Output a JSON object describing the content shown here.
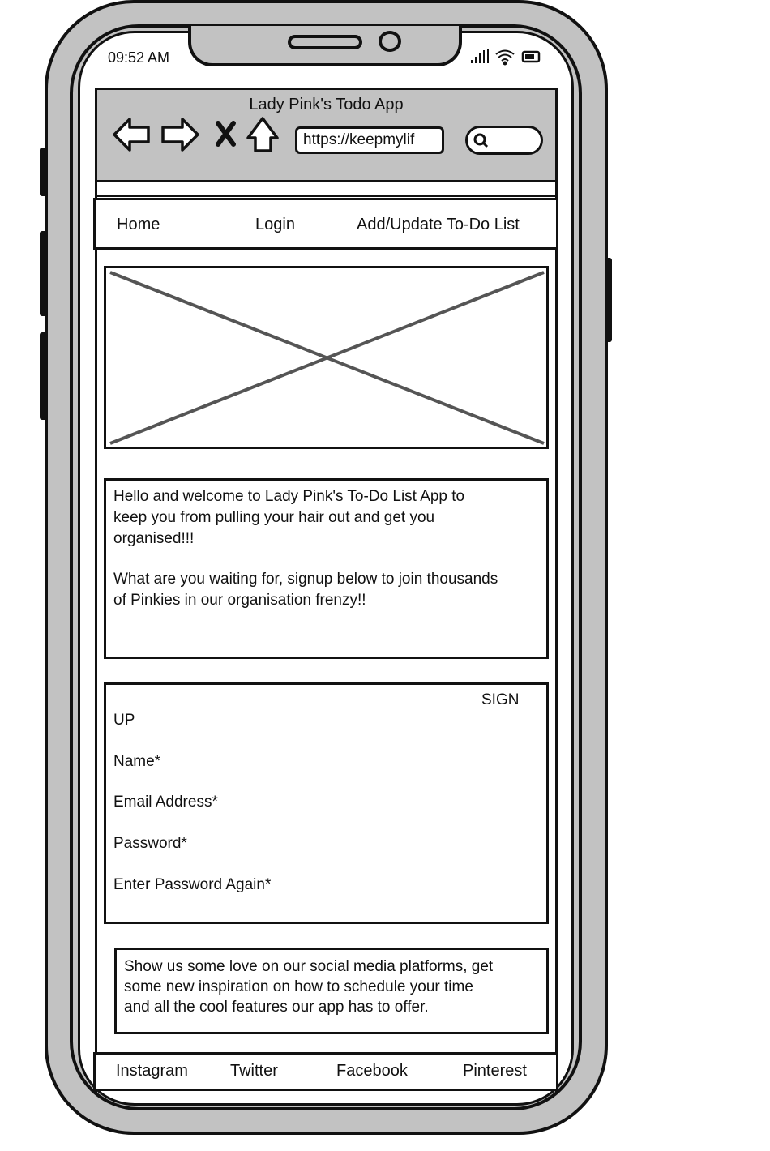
{
  "status_bar": {
    "time": "09:52 AM",
    "icons": [
      "signal-icon",
      "wifi-icon",
      "battery-icon"
    ]
  },
  "browser": {
    "title": "Lady Pink's Todo App",
    "url": "https://keepmylif",
    "nav_icons": [
      "back-arrow-icon",
      "forward-arrow-icon",
      "close-icon",
      "home-icon"
    ],
    "search_icon": "search-icon"
  },
  "navbar": {
    "items": [
      "Home",
      "Login",
      "Add/Update To-Do List"
    ]
  },
  "hero": {
    "placeholder_icon": "image-placeholder-icon"
  },
  "welcome": {
    "line1": "Hello and welcome to Lady Pink's To-Do List App to",
    "line2": "keep you from pulling your hair out and get you",
    "line3": "organised!!!",
    "line4": "What are you waiting for, signup below to join thousands",
    "line5": "of Pinkies in our organisation frenzy!!"
  },
  "signup": {
    "title_part1": "SIGN",
    "title_part2": "UP",
    "fields": [
      "Name*",
      "Email Address*",
      "Password*",
      "Enter Password Again*"
    ]
  },
  "social": {
    "line1": "Show us some love on our social media platforms, get",
    "line2": "some new inspiration on how to schedule your time",
    "line3": "and all the cool features our app has to offer."
  },
  "footer": {
    "links": [
      "Instagram",
      "Twitter",
      "Facebook",
      "Pinterest"
    ]
  },
  "colors": {
    "frame": "#c2c2c2",
    "ink": "#111111",
    "screen": "#ffffff"
  }
}
